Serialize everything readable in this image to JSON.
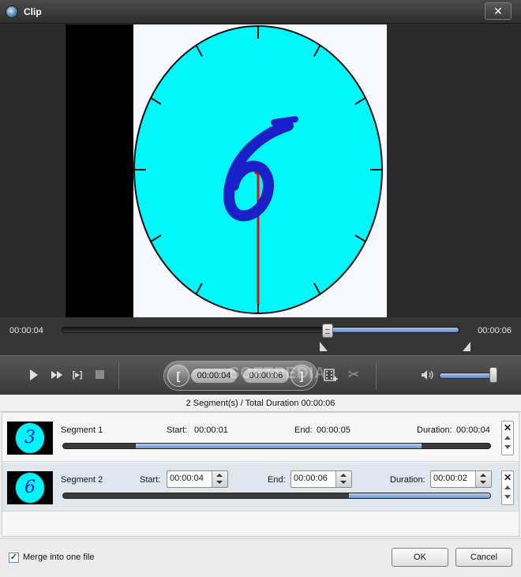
{
  "window": {
    "title": "Clip",
    "close_glyph": "✕"
  },
  "player": {
    "current_time": "00:00:04",
    "total_time": "00:00:06",
    "progress_fraction": 0.66,
    "selection_start_fraction": 0.66,
    "selection_end_fraction": 1.0,
    "frame": {
      "digit": "6",
      "bg_color": "#00f8fa",
      "digit_color": "#1a20c8",
      "hand_color": "#e01010"
    }
  },
  "controls": {
    "framestep_glyph": "[▸]",
    "bracket_left": "[",
    "bracket_right": "]",
    "start_time": "00:00:04",
    "end_time": "00:00:06",
    "watermark": "SOFTPEDIA",
    "scissors_glyph": "✂",
    "volume_fraction": 0.95
  },
  "summary": "2 Segment(s) / Total Duration 00:00:06",
  "segments": [
    {
      "thumb_digit": "3",
      "name": "Segment 1",
      "start_label": "Start:",
      "start": "00:00:01",
      "end_label": "End:",
      "end": "00:00:05",
      "duration_label": "Duration:",
      "duration": "00:00:04",
      "range": [
        0.17,
        0.84
      ]
    },
    {
      "thumb_digit": "6",
      "name": "Segment 2",
      "start_label": "Start:",
      "start": "00:00:04",
      "end_label": "End:",
      "end": "00:00:06",
      "duration_label": "Duration:",
      "duration": "00:00:02",
      "range": [
        0.67,
        1.0
      ]
    }
  ],
  "row_tools": {
    "close_glyph": "✕"
  },
  "footer": {
    "merge_label": "Merge into one file",
    "merge_checked": true,
    "check_glyph": "✓",
    "ok_label": "OK",
    "cancel_label": "Cancel"
  }
}
